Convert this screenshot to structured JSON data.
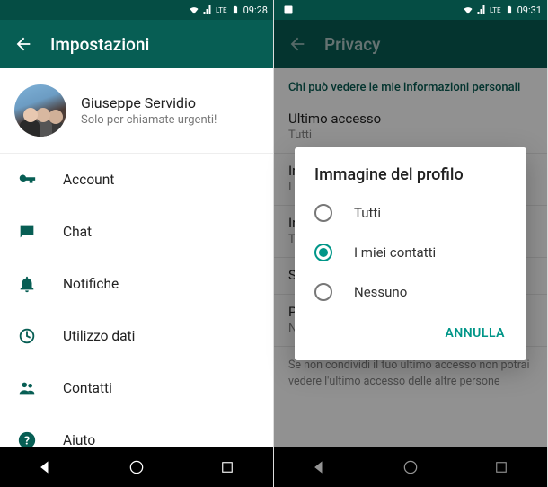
{
  "left": {
    "status_time": "09:28",
    "header_title": "Impostazioni",
    "profile": {
      "name": "Giuseppe Servidio",
      "status": "Solo per chiamate urgenti!"
    },
    "items": [
      {
        "label": "Account"
      },
      {
        "label": "Chat"
      },
      {
        "label": "Notifiche"
      },
      {
        "label": "Utilizzo dati"
      },
      {
        "label": "Contatti"
      },
      {
        "label": "Aiuto"
      }
    ]
  },
  "right": {
    "status_time": "09:31",
    "header_title": "Privacy",
    "section_header": "Chi può vedere le mie informazioni personali",
    "prefs": [
      {
        "title": "Ultimo accesso",
        "sub": "Tutti"
      },
      {
        "title": "Immagine del profilo",
        "sub": "I miei contatti"
      },
      {
        "title": "Info",
        "sub": "Tutti"
      },
      {
        "title": "Stato",
        "sub": ""
      },
      {
        "title": "Posizione attuale",
        "sub": "Nessuno"
      }
    ],
    "info_text": "Se non condividi il tuo ultimo accesso non potrai vedere l'ultimo accesso delle altre persone",
    "dialog": {
      "title": "Immagine del profilo",
      "options": [
        {
          "label": "Tutti",
          "selected": false
        },
        {
          "label": "I miei contatti",
          "selected": true
        },
        {
          "label": "Nessuno",
          "selected": false
        }
      ],
      "cancel": "ANNULLA"
    }
  }
}
